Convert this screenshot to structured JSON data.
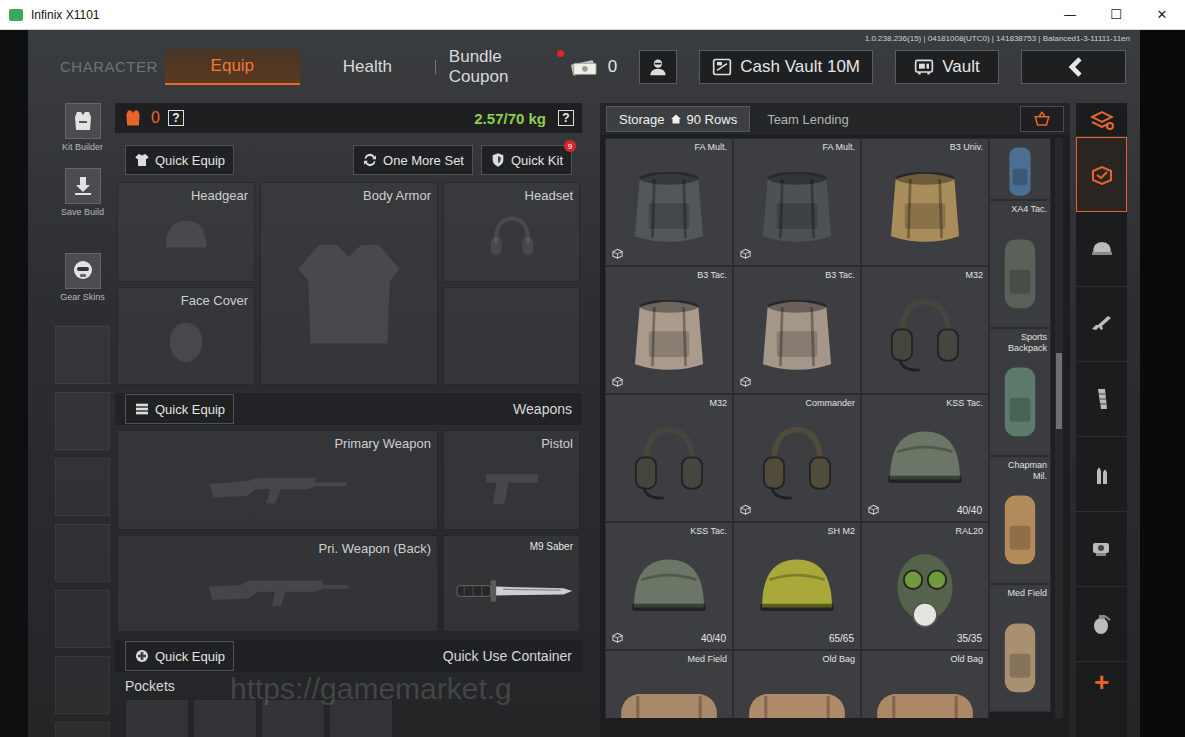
{
  "window": {
    "title": "Infinix X1101",
    "controls": [
      "—",
      "☐",
      "✕"
    ]
  },
  "build_info": "1.0.238.236(15) | 04181008(UTC0) | 141838753 | Balanced1-3-11111-11en",
  "nav": {
    "section": "CHARACTER",
    "tabs": [
      {
        "label": "Equip",
        "selected": true,
        "dot": false
      },
      {
        "label": "Health",
        "selected": false,
        "dot": false
      },
      {
        "label": "Bundle Coupon",
        "selected": false,
        "dot": true
      }
    ],
    "cash": "0",
    "buttons": [
      {
        "label": "Cash Vault 10M",
        "kind": "cash-vault"
      },
      {
        "label": "Vault",
        "kind": "vault"
      }
    ]
  },
  "sidebar": {
    "items": [
      {
        "label": "Kit Builder",
        "kind": "kit"
      },
      {
        "label": "Save Build",
        "kind": "save"
      },
      {
        "label": "Gear Skins",
        "kind": "skins"
      }
    ],
    "empty_slots": 7
  },
  "loadout": {
    "armor_count": "0",
    "help": "?",
    "weight": "2.57/70 kg",
    "actions": [
      {
        "label": "Quick Equip",
        "kind": "equip",
        "badge": ""
      },
      {
        "label": "One More Set",
        "kind": "refresh",
        "badge": ""
      },
      {
        "label": "Quick Kit",
        "kind": "kit",
        "badge": "9"
      }
    ],
    "gear": [
      {
        "label": "Headgear",
        "kind": "helmet"
      },
      {
        "label": "Body Armor",
        "kind": "vest"
      },
      {
        "label": "Headset",
        "kind": "headset"
      },
      {
        "label": "Face Cover",
        "kind": "mask"
      }
    ],
    "weapons_header": {
      "button": "Quick Equip",
      "title": "Weapons"
    },
    "weapons": [
      {
        "label": "Primary Weapon",
        "kind": "rifle",
        "equipped": false
      },
      {
        "label": "Pistol",
        "kind": "pistol",
        "equipped": false
      },
      {
        "label": "Pri. Weapon (Back)",
        "kind": "rifle2",
        "equipped": false
      },
      {
        "label": "M9 Saber",
        "kind": "knife",
        "equipped": true
      }
    ],
    "container_header": {
      "button": "Quick Equip",
      "title": "Quick Use Container"
    },
    "pockets": {
      "label": "Pockets",
      "slots": 4
    }
  },
  "storage": {
    "tabs": [
      {
        "label": "Storage",
        "rows": "90 Rows",
        "selected": true
      },
      {
        "label": "Team Lending",
        "rows": "",
        "selected": false
      }
    ],
    "scroll_level": 0.37,
    "items": [
      {
        "name": "FA Mult.",
        "kind": "bag",
        "color": "#545759",
        "durability": "",
        "tag": true
      },
      {
        "name": "FA Mult.",
        "kind": "bag",
        "color": "#4e5153",
        "durability": "",
        "tag": true
      },
      {
        "name": "B3 Univ.",
        "kind": "bag",
        "color": "#a88c5a",
        "durability": "",
        "tag": false
      },
      {
        "name": "B3 Tac.",
        "kind": "bag",
        "color": "#a99a8c",
        "durability": "",
        "tag": true
      },
      {
        "name": "B3 Tac.",
        "kind": "bag",
        "color": "#a5968a",
        "durability": "",
        "tag": true
      },
      {
        "name": "M32",
        "kind": "headset",
        "color": "#45473f",
        "durability": "",
        "tag": false
      },
      {
        "name": "M32",
        "kind": "headset",
        "color": "#45473f",
        "durability": "",
        "tag": false
      },
      {
        "name": "Commander",
        "kind": "headset",
        "color": "#514b3c",
        "durability": "",
        "tag": true
      },
      {
        "name": "KSS Tac.",
        "kind": "helmet",
        "color": "#6b7666",
        "durability": "40/40",
        "tag": true
      },
      {
        "name": "KSS Tac.",
        "kind": "helmet",
        "color": "#6b7666",
        "durability": "40/40",
        "tag": true
      },
      {
        "name": "SH M2",
        "kind": "helmet",
        "color": "#a9a83a",
        "durability": "65/65",
        "tag": false
      },
      {
        "name": "RAL20",
        "kind": "mask",
        "color": "#56634c",
        "durability": "35/35",
        "tag": false
      },
      {
        "name": "Med Field",
        "kind": "roll",
        "color": "#a88a6a",
        "durability": "",
        "tag": false
      },
      {
        "name": "Old Bag",
        "kind": "roll",
        "color": "#b08b6a",
        "durability": "",
        "tag": false
      },
      {
        "name": "Old Bag",
        "kind": "roll",
        "color": "#ad8867",
        "durability": "",
        "tag": false
      }
    ],
    "side_items": [
      {
        "name": "",
        "color": "#4b6f92",
        "partial": true
      },
      {
        "name": "XA4 Tac.",
        "color": "#5b6159",
        "partial": false
      },
      {
        "name": "Sports Backpack",
        "color": "#5c7b6c",
        "partial": false
      },
      {
        "name": "Chapman Mil.",
        "color": "#b38b5a",
        "partial": false
      },
      {
        "name": "Med Field",
        "color": "#a89070",
        "partial": false
      }
    ]
  },
  "categories": [
    {
      "kind": "stack",
      "selected": false
    },
    {
      "kind": "storage",
      "selected": true
    },
    {
      "kind": "helmet",
      "selected": false
    },
    {
      "kind": "rifle",
      "selected": false
    },
    {
      "kind": "magazine",
      "selected": false
    },
    {
      "kind": "ammo",
      "selected": false
    },
    {
      "kind": "scope",
      "selected": false
    },
    {
      "kind": "grenade",
      "selected": false
    }
  ],
  "add_button": "+",
  "watermark": "https://gamemarket.g"
}
